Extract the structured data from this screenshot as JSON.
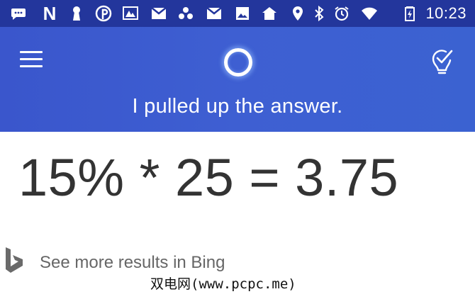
{
  "status_bar": {
    "icons": [
      "chat-bubble-icon",
      "netflix-icon",
      "keyhole-icon",
      "pinterest-icon",
      "photo-gallery-icon",
      "gmail-icon",
      "dots-cluster-icon",
      "gmail-icon",
      "image-icon",
      "house-icon",
      "location-pin-icon",
      "bluetooth-icon",
      "alarm-icon",
      "wifi-icon",
      "battery-icon"
    ],
    "netflix_letter": "N",
    "time": "10:23"
  },
  "app_bar": {
    "menu_icon": "hamburger-menu-icon",
    "assistant_icon": "cortana-ring-icon",
    "notebook_icon": "lightbulb-check-icon",
    "message": "I pulled up the answer."
  },
  "answer": {
    "expression": "15% * 25 = 3.75"
  },
  "bing_link": {
    "icon": "bing-logo-icon",
    "label": "See more results in Bing"
  },
  "watermark": {
    "text": "双电网(www.pcpc.me)"
  },
  "colors": {
    "status_bar": "#23369c",
    "app_bar": "#3e5fd2",
    "result_text": "#333333",
    "link_text": "#666666"
  }
}
